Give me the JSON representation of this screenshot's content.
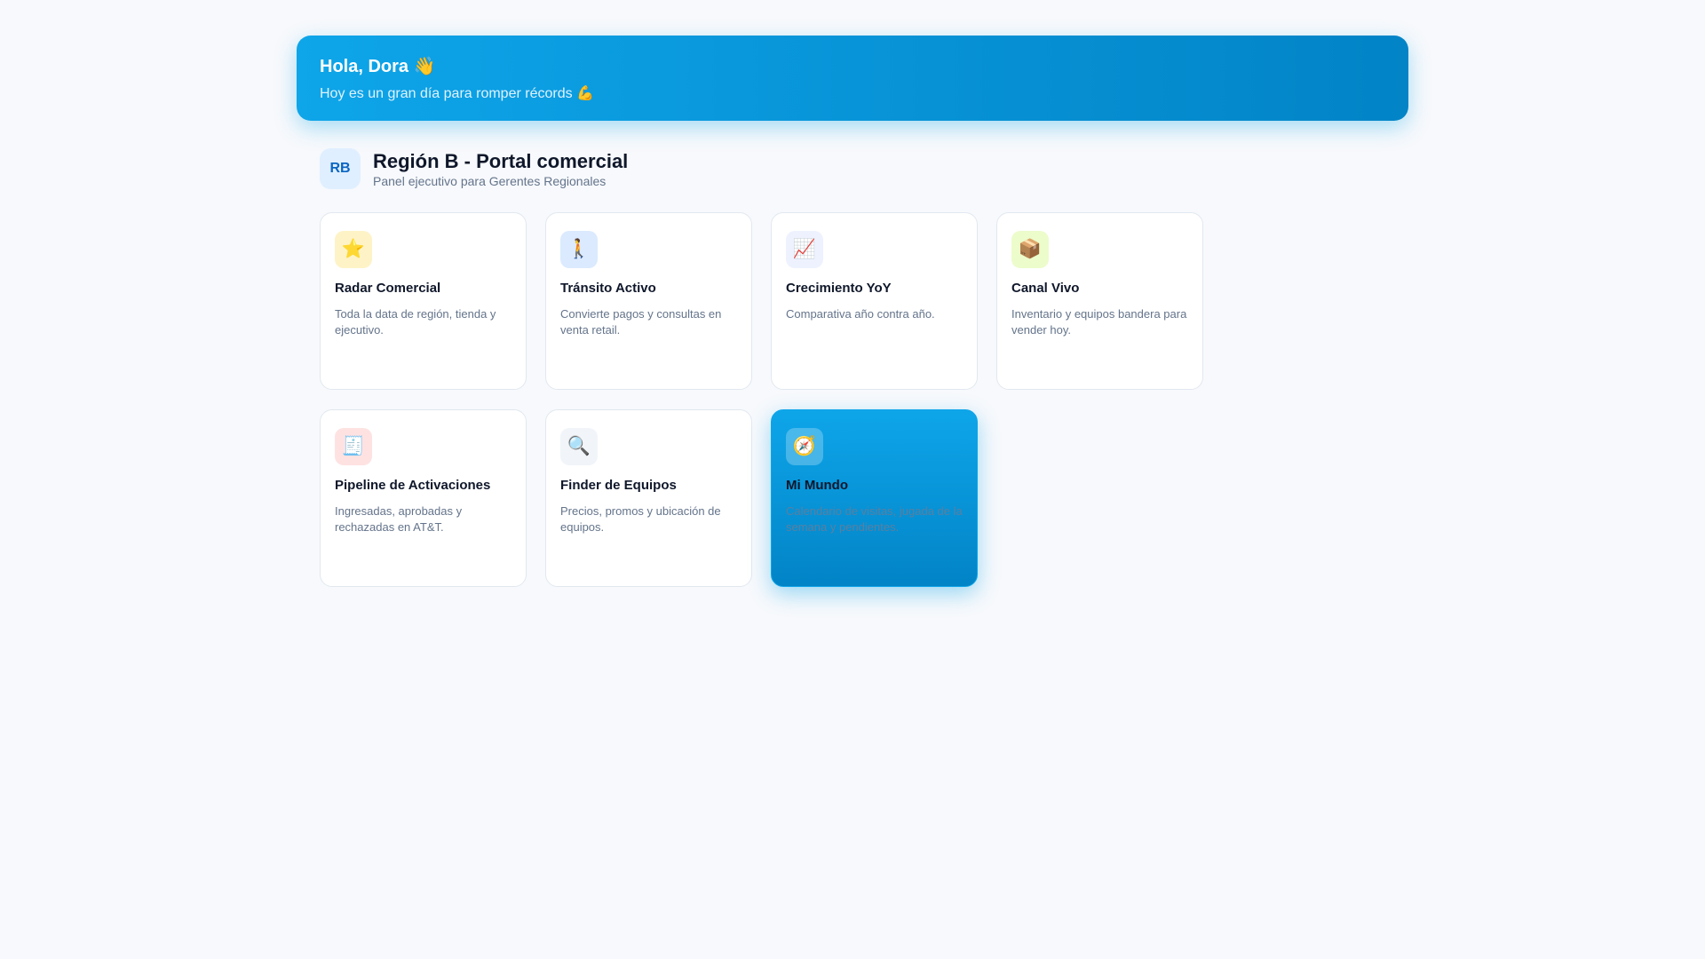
{
  "banner": {
    "greeting": "Hola, Dora 👋",
    "subtitle": "Hoy es un gran día para romper récords 💪"
  },
  "header": {
    "badge": "RB",
    "title": "Región B - Portal comercial",
    "subtitle": "Panel ejecutivo para Gerentes Regionales"
  },
  "cards": [
    {
      "icon": "⭐",
      "title": "Radar Comercial",
      "desc": "Toda la data de región, tienda y ejecutivo."
    },
    {
      "icon": "🚶",
      "title": "Tránsito Activo",
      "desc": "Convierte pagos y consultas en venta retail."
    },
    {
      "icon": "📈",
      "title": "Crecimiento YoY",
      "desc": "Comparativa año contra año."
    },
    {
      "icon": "📦",
      "title": "Canal Vivo",
      "desc": "Inventario y equipos bandera para vender hoy."
    },
    {
      "icon": "🧾",
      "title": "Pipeline de Activaciones",
      "desc": "Ingresadas, aprobadas y rechazadas en AT&T."
    },
    {
      "icon": "🔍",
      "title": "Finder de Equipos",
      "desc": "Precios, promos y ubicación de equipos."
    },
    {
      "icon": "🧭",
      "title": "Mi Mundo",
      "desc": "Calendario de visitas, jugada de la semana y pendientes."
    }
  ]
}
